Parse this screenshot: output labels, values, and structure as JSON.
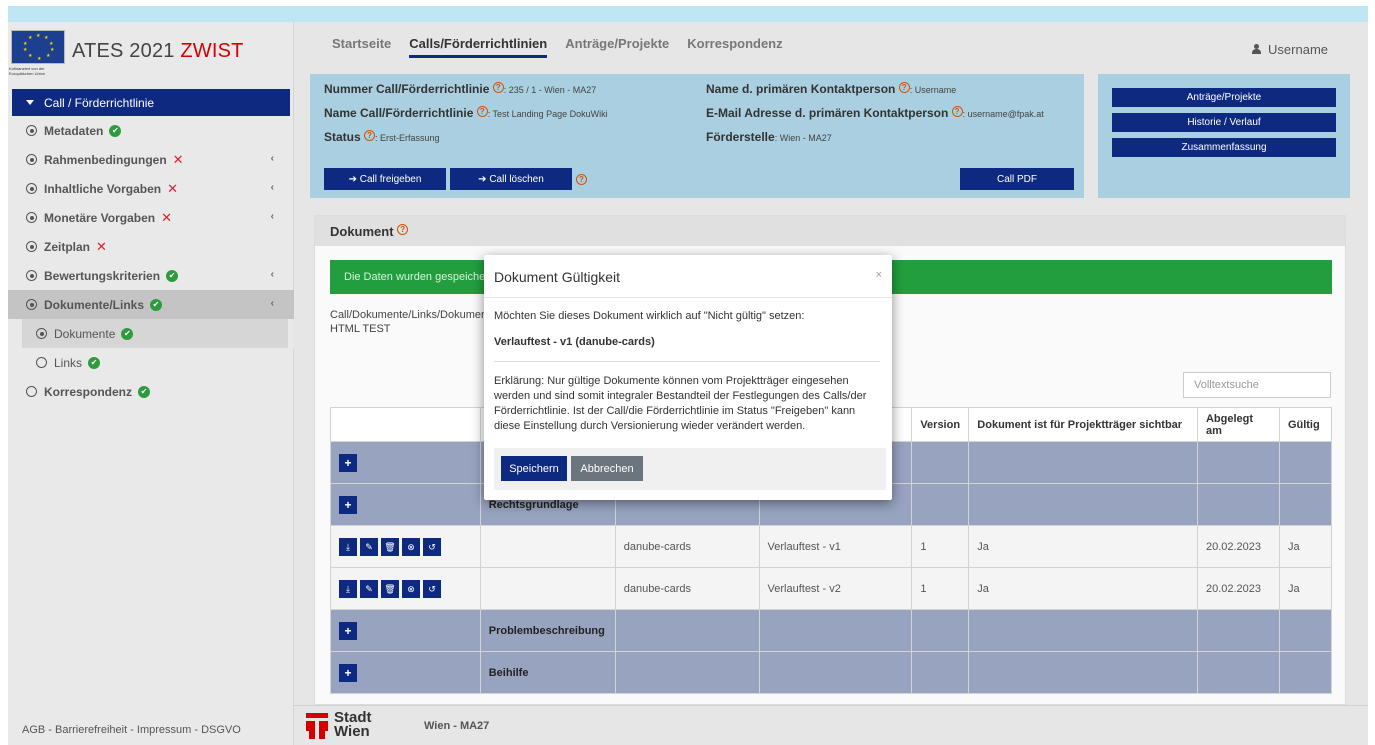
{
  "brand": {
    "title": "ATES 2021",
    "title_highlight": "ZWIST",
    "eu_caption": "Kofinanziert von der Europäischen Union"
  },
  "sidebar": {
    "items": [
      {
        "label": "Call / Förderrichtlinie",
        "status": "",
        "active": true
      },
      {
        "label": "Metadaten",
        "status": "ok"
      },
      {
        "label": "Rahmenbedingungen",
        "status": "error",
        "chevron": "‹"
      },
      {
        "label": "Inhaltliche Vorgaben",
        "status": "error",
        "chevron": "‹"
      },
      {
        "label": "Monetäre Vorgaben",
        "status": "error",
        "chevron": "‹"
      },
      {
        "label": "Zeitplan",
        "status": "error"
      },
      {
        "label": "Bewertungskriterien",
        "status": "ok",
        "chevron": "‹"
      },
      {
        "label": "Dokumente/Links",
        "status": "ok",
        "chevron": "‹"
      },
      {
        "label": "Dokumente",
        "status": "ok"
      },
      {
        "label": "Links",
        "status": "ok"
      },
      {
        "label": "Korrespondenz",
        "status": "ok"
      }
    ],
    "footer": "AGB - Barrierefreiheit - Impressum - DSGVO"
  },
  "header": {
    "tabs": [
      "Startseite",
      "Calls/Förderrichtlinien",
      "Anträge/Projekte",
      "Korrespondenz"
    ],
    "active_tab": "Calls/Förderrichtlinien",
    "username": "Username"
  },
  "info": {
    "nummer_label": "Nummer Call/Förderrichtlinie",
    "nummer_value": ": 235 / 1 - Wien - MA27",
    "name_label": "Name Call/Förderrichtlinie",
    "name_value": ": Test Landing Page DokuWiki",
    "status_label": "Status",
    "status_value": ": Erst-Erfassung",
    "kontakt_label": "Name d. primären Kontaktperson",
    "kontakt_value": ": Username",
    "email_label": "E-Mail Adresse d. primären Kontaktperson",
    "email_value": ": username@fpak.at",
    "foerder_label": "Förderstelle",
    "foerder_value": ": Wien - MA27",
    "btn_freigeben": "➔ Call freigeben",
    "btn_loeschen": "➔ Call löschen",
    "btn_pdf": "Call PDF",
    "side_buttons": [
      "Anträge/Projekte",
      "Historie / Verlauf",
      "Zusammenfassung"
    ]
  },
  "document": {
    "heading": "Dokument",
    "success_text": "Die Daten wurden gespeichert",
    "breadcrumb": "Call/Dokumente/Links/Dokumente",
    "breadcrumb_2": "HTML TEST",
    "search_placeholder": "Volltextsuche",
    "columns": [
      "",
      "",
      "",
      "",
      "Version",
      "Dokument ist für Projektträger sichtbar",
      "Abgelegt am",
      "Gültig"
    ],
    "rows": [
      {
        "type": "group",
        "label": ""
      },
      {
        "type": "group",
        "label": "Rechtsgrundlage"
      },
      {
        "type": "data",
        "file": "danube-cards",
        "name": "Verlauftest - v1",
        "version": "1",
        "visible": "Ja",
        "date": "20.02.2023",
        "valid": "Ja"
      },
      {
        "type": "data",
        "file": "danube-cards",
        "name": "Verlauftest - v2",
        "version": "1",
        "visible": "Ja",
        "date": "20.02.2023",
        "valid": "Ja"
      },
      {
        "type": "group",
        "label": "Problembeschreibung"
      },
      {
        "type": "group",
        "label": "Beihilfe"
      }
    ]
  },
  "footer": {
    "logo_line1": "Stadt",
    "logo_line2": "Wien",
    "dept": "Wien - MA27"
  },
  "modal": {
    "title": "Dokument Gültigkeit",
    "close": "×",
    "question": "Möchten Sie dieses Dokument wirklich auf \"Nicht gültig\" setzen:",
    "doc_name": "Verlauftest - v1 (danube-cards)",
    "explanation": "Erklärung: Nur gültige Dokumente können vom Projektträger eingesehen werden und sind somit integraler Bestandteil der Festlegungen des Calls/der Förderrichtlinie. Ist der Call/die Förderrichtlinie im Status \"Freigeben\" kann diese Einstellung durch Versionierung wieder verändert werden.",
    "save": "Speichern",
    "cancel": "Abbrechen"
  },
  "colors": {
    "primary": "#0e2a80",
    "success": "#239e3e",
    "error": "#d9232d",
    "info_panel": "#a9cfe0",
    "brand_red": "#d40000"
  }
}
